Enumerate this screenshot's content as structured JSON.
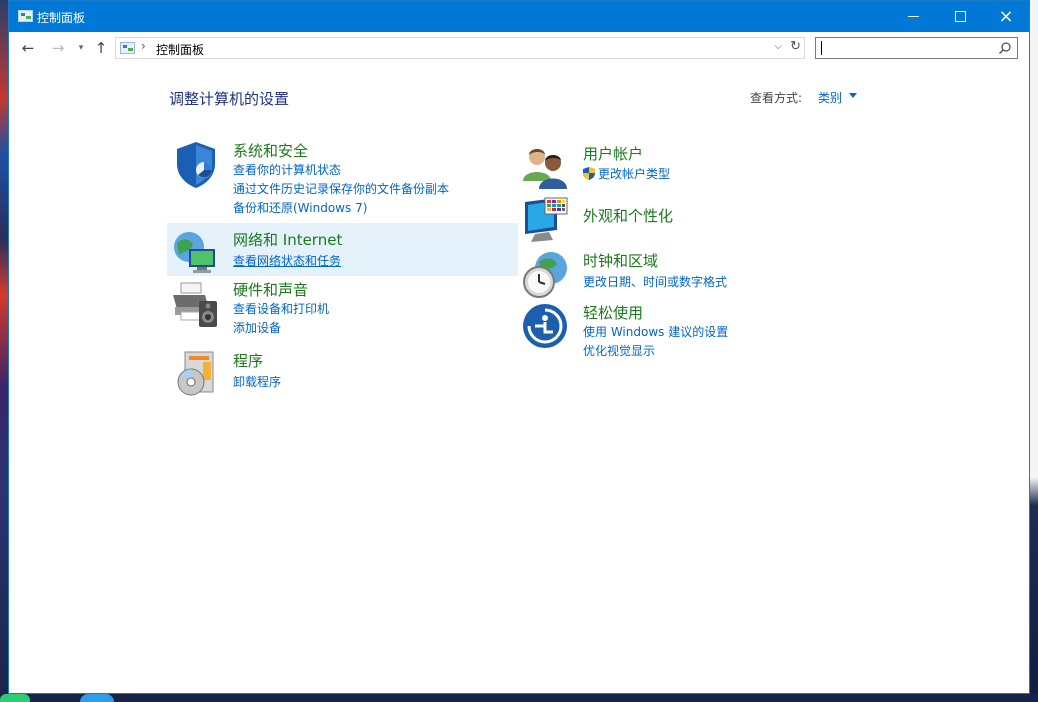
{
  "window": {
    "title": "控制面板",
    "buttons": {
      "minimize": "minimize",
      "maximize": "maximize",
      "close": "×"
    }
  },
  "address": {
    "path": "控制面板",
    "search_placeholder": ""
  },
  "header": {
    "title": "调整计算机的设置",
    "view_by_label": "查看方式:",
    "view_by_value": "类别"
  },
  "categories": [
    {
      "name": "系统和安全",
      "icon": "shield-icon",
      "links": [
        "查看你的计算机状态",
        "通过文件历史记录保存你的文件备份副本",
        "备份和还原(Windows 7)"
      ]
    },
    {
      "name": "网络和 Internet",
      "icon": "network-globe-icon",
      "links": [
        "查看网络状态和任务"
      ]
    },
    {
      "name": "硬件和声音",
      "icon": "printer-speaker-icon",
      "links": [
        "查看设备和打印机",
        "添加设备"
      ]
    },
    {
      "name": "程序",
      "icon": "program-disc-icon",
      "links": [
        "卸载程序"
      ]
    },
    {
      "name": "用户帐户",
      "icon": "users-icon",
      "links": [
        "更改帐户类型"
      ]
    },
    {
      "name": "外观和个性化",
      "icon": "monitor-palette-icon",
      "links": []
    },
    {
      "name": "时钟和区域",
      "icon": "clock-globe-icon",
      "links": [
        "更改日期、时间或数字格式"
      ]
    },
    {
      "name": "轻松使用",
      "icon": "ease-of-access-icon",
      "links": [
        "使用 Windows 建议的设置",
        "优化视觉显示"
      ]
    }
  ],
  "colors": {
    "titlebar": "#0078d7",
    "category_title": "#1b7a1b",
    "link": "#0066cc",
    "page_title": "#1e3287",
    "hover_highlight": "#e5f1fb"
  }
}
